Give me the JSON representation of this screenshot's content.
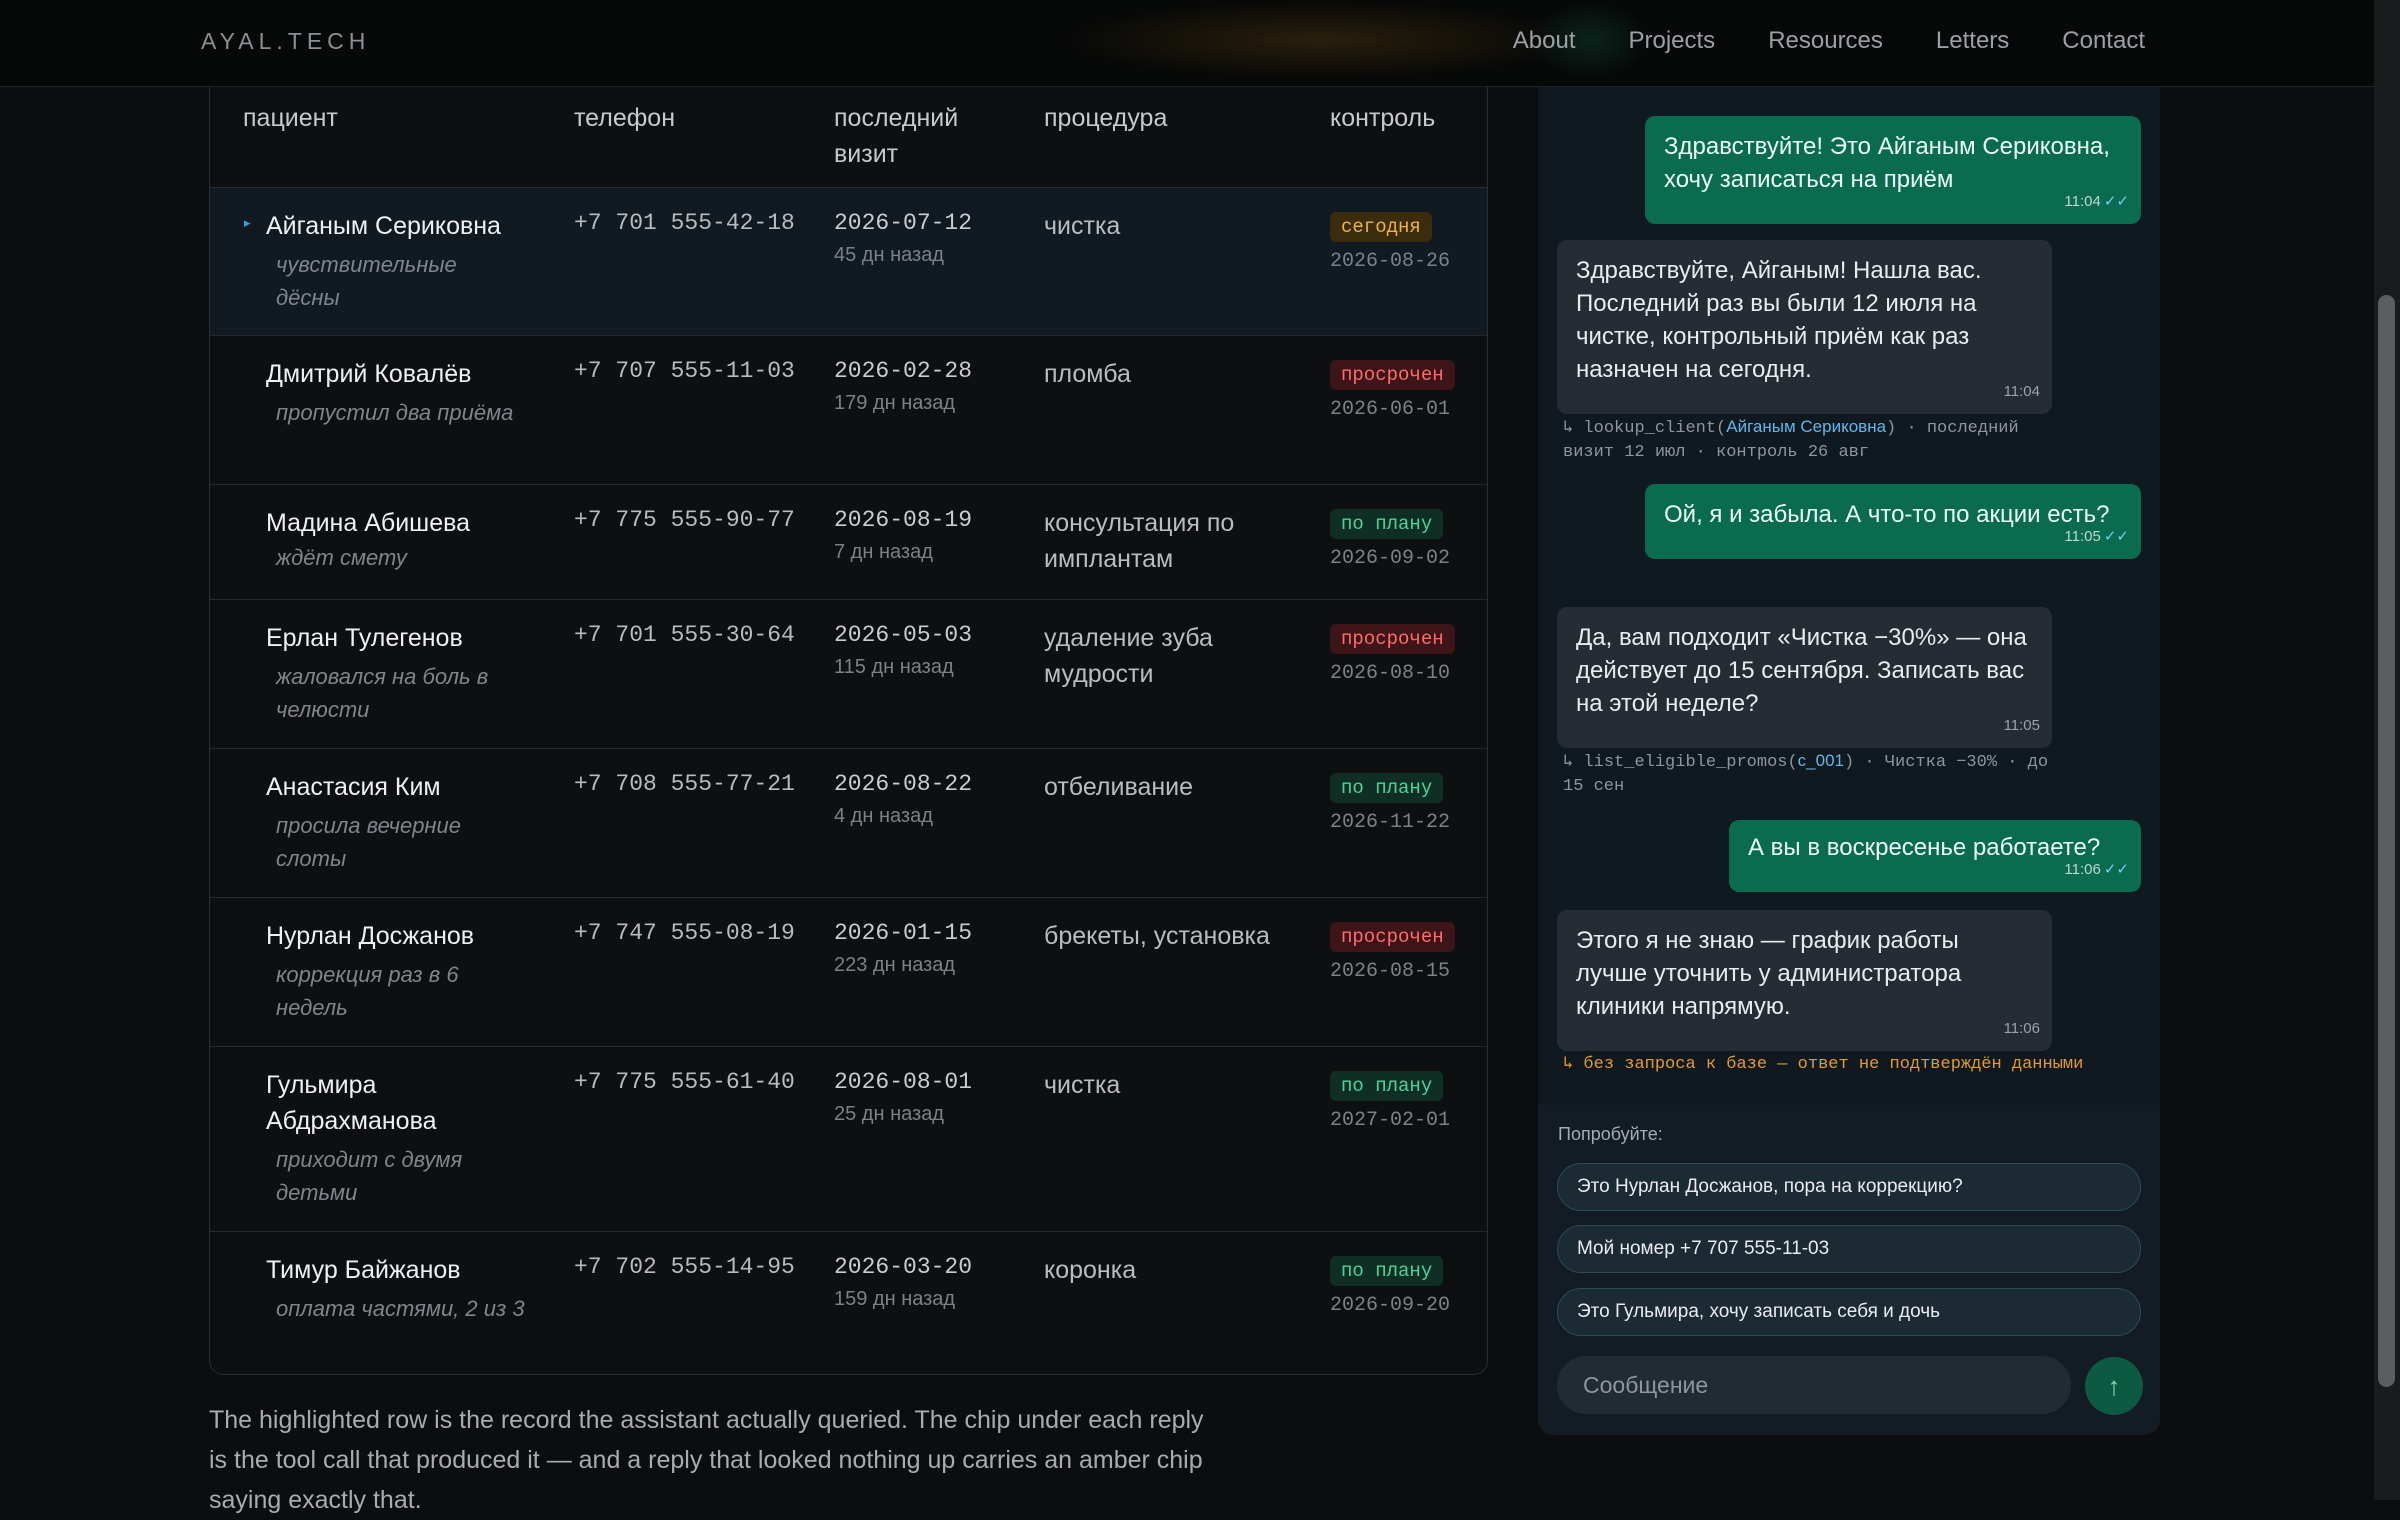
{
  "header": {
    "logo": "AYAL.TECH",
    "nav": [
      "About",
      "Projects",
      "Resources",
      "Letters",
      "Contact"
    ]
  },
  "table": {
    "columns": {
      "patient": "пациент",
      "phone": "телефон",
      "last_visit_1": "последний",
      "last_visit_2": "визит",
      "procedure": "процедура",
      "control": "контроль"
    },
    "rows": [
      {
        "name": "Айганым Сериковна",
        "note": "чувствительные дёсны",
        "phone": "+7 701 555-42-18",
        "date": "2026-07-12",
        "ago": "45 дн назад",
        "procedure": "чистка",
        "status": "сегодня",
        "control": "2026-08-26"
      },
      {
        "name": "Дмитрий Ковалёв",
        "note": "пропустил два приёма",
        "phone": "+7 707 555-11-03",
        "date": "2026-02-28",
        "ago": "179 дн назад",
        "procedure": "пломба",
        "status": "просрочен",
        "control": "2026-06-01"
      },
      {
        "name": "Мадина Абишева",
        "note": "ждёт смету",
        "phone": "+7 775 555-90-77",
        "date": "2026-08-19",
        "ago": "7 дн назад",
        "procedure": "консультация по имплантам",
        "status": "по плану",
        "control": "2026-09-02"
      },
      {
        "name": "Ерлан Тулегенов",
        "note": "жаловался на боль в челюсти",
        "phone": "+7 701 555-30-64",
        "date": "2026-05-03",
        "ago": "115 дн назад",
        "procedure": "удаление зуба мудрости",
        "status": "просрочен",
        "control": "2026-08-10"
      },
      {
        "name": "Анастасия Ким",
        "note": "просила вечерние слоты",
        "phone": "+7 708 555-77-21",
        "date": "2026-08-22",
        "ago": "4 дн назад",
        "procedure": "отбеливание",
        "status": "по плану",
        "control": "2026-11-22"
      },
      {
        "name": "Нурлан Досжанов",
        "note": "коррекция раз в 6 недель",
        "phone": "+7 747 555-08-19",
        "date": "2026-01-15",
        "ago": "223 дн назад",
        "procedure": "брекеты, установка",
        "status": "просрочен",
        "control": "2026-08-15"
      },
      {
        "name": "Гульмира Абдрахманова",
        "note": "приходит с двумя детьми",
        "phone": "+7 775 555-61-40",
        "date": "2026-08-01",
        "ago": "25 дн назад",
        "procedure": "чистка",
        "status": "по плану",
        "control": "2027-02-01"
      },
      {
        "name": "Тимур Байжанов",
        "note": "оплата частями, 2 из 3",
        "phone": "+7 702 555-14-95",
        "date": "2026-03-20",
        "ago": "159 дн назад",
        "procedure": "коронка",
        "status": "по плану",
        "control": "2026-09-20"
      }
    ]
  },
  "footnote": "The highlighted row is the record the assistant actually queried. The chip under each reply is the tool call that produced it — and a reply that looked nothing up carries an amber chip saying exactly that.",
  "chat": {
    "messages": [
      {
        "text": "Здравствуйте! Это Айганым Сериковна, хочу записаться на приём",
        "time": "11:04"
      },
      {
        "text": "Здравствуйте, Айганым! Нашла вас. Последний раз вы были 12 июля на чистке, контрольный приём как раз назначен на сегодня.",
        "time": "11:04"
      },
      {
        "text": "Ой, я и забыла. А что-то по акции есть?",
        "time": "11:05"
      },
      {
        "text": "Да, вам подходит «Чистка −30%» — она действует до 15 сентября. Записать вас на этой неделе?",
        "time": "11:05"
      },
      {
        "text": "А вы в воскресенье работаете?",
        "time": "11:06"
      },
      {
        "text": "Этого я не знаю — график работы лучше уточнить у администратора клиники напрямую.",
        "time": "11:06"
      }
    ],
    "ticks": "✓✓",
    "tool1": {
      "prefix": "↳ lookup_client(",
      "arg": "Айганым Сериковна",
      "suffix": ") · последний визит 12 июл · контроль 26 авг"
    },
    "tool2": {
      "prefix": "↳ list_eligible_promos(",
      "arg": "c_001",
      "suffix": ") · Чистка −30% · до 15 сен"
    },
    "tool3": "↳ без запроса к базе — ответ не подтверждён данными",
    "try_label": "Попробуйте:",
    "suggestions": [
      "Это Нурлан Досжанов, пора на коррекцию?",
      "Мой номер +7 707 555-11-03",
      "Это Гульмира, хочу записать себя и дочь"
    ],
    "input_placeholder": "Сообщение",
    "send_icon": "↑"
  },
  "colors": {
    "accent_green": "#0a6b4e",
    "status_today": "#f0b43c",
    "status_late": "#ff6b6b",
    "status_ok": "#4cd49a",
    "tool_arg": "#5fb8ea",
    "warn": "#e59a2e"
  }
}
